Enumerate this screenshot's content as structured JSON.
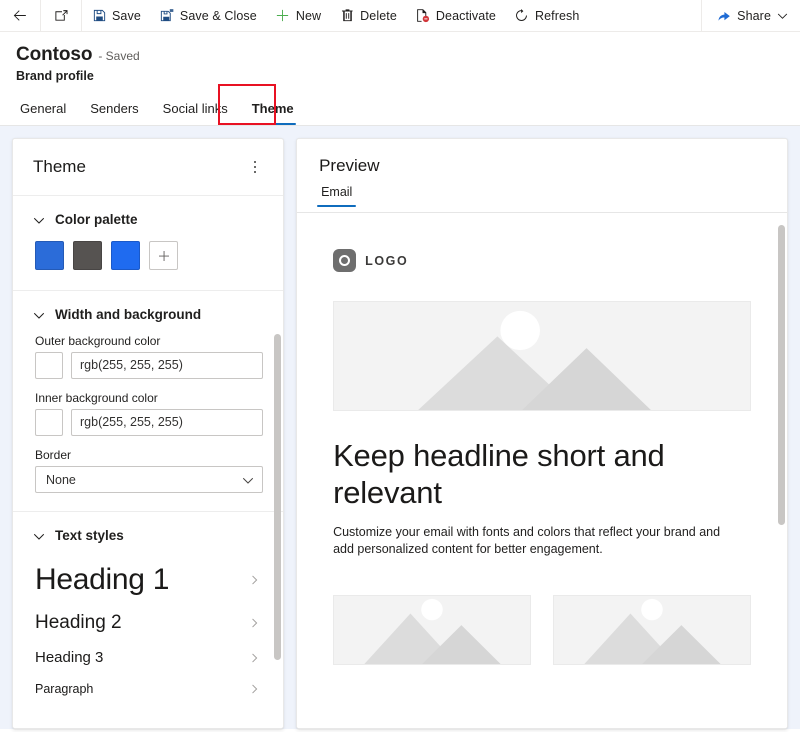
{
  "commandbar": {
    "back": {
      "label": "",
      "icon": "back-arrow-icon"
    },
    "popout": {
      "label": "",
      "icon": "open-in-new-window-icon"
    },
    "buttons": [
      {
        "id": "save",
        "label": "Save",
        "icon": "save-icon"
      },
      {
        "id": "save-close",
        "label": "Save & Close",
        "icon": "save-and-close-icon"
      },
      {
        "id": "new",
        "label": "New",
        "icon": "plus-icon"
      },
      {
        "id": "delete",
        "label": "Delete",
        "icon": "trash-icon"
      },
      {
        "id": "deactivate",
        "label": "Deactivate",
        "icon": "deactivate-icon"
      },
      {
        "id": "refresh",
        "label": "Refresh",
        "icon": "refresh-icon"
      }
    ],
    "share": {
      "label": "Share",
      "icon": "share-icon",
      "chevron": "chevron-down-icon"
    }
  },
  "record": {
    "name": "Contoso",
    "state": "- Saved",
    "type": "Brand profile"
  },
  "tabs": [
    {
      "label": "General",
      "active": false
    },
    {
      "label": "Senders",
      "active": false
    },
    {
      "label": "Social links",
      "active": false
    },
    {
      "label": "Theme",
      "active": true
    }
  ],
  "theme_panel": {
    "title": "Theme",
    "more_options": "more-options-icon",
    "color_palette": {
      "label": "Color palette",
      "swatches": [
        "#2b6cd9",
        "#565351",
        "#1f6bf0"
      ],
      "add_label": "+"
    },
    "width_background": {
      "label": "Width and background",
      "outer_background": {
        "label": "Outer background color",
        "value": "rgb(255, 255, 255)",
        "swatch": "#ffffff"
      },
      "inner_background": {
        "label": "Inner background color",
        "value": "rgb(255, 255, 255)",
        "swatch": "#ffffff"
      },
      "border": {
        "label": "Border",
        "value": "None"
      }
    },
    "text_styles": {
      "label": "Text styles",
      "items": [
        {
          "label": "Heading 1"
        },
        {
          "label": "Heading 2"
        },
        {
          "label": "Heading 3"
        },
        {
          "label": "Paragraph"
        }
      ]
    }
  },
  "preview": {
    "title": "Preview",
    "tabs": [
      {
        "label": "Email",
        "active": true
      }
    ],
    "email": {
      "logo_text": "LOGO",
      "headline": "Keep headline short and relevant",
      "body": "Customize your email with fonts and colors that reflect your brand and add personalized content for better engagement."
    }
  },
  "colors": {
    "accent": "#0f6cbd",
    "annotation": "#e81123",
    "page_background": "#eff3fb"
  }
}
